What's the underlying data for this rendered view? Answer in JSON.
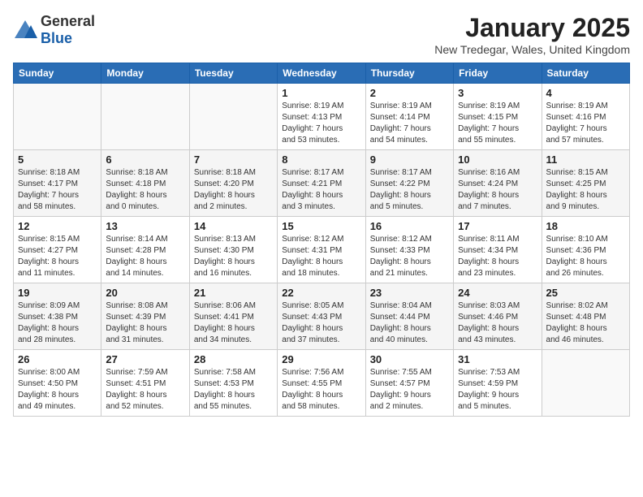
{
  "header": {
    "logo_general": "General",
    "logo_blue": "Blue",
    "title": "January 2025",
    "subtitle": "New Tredegar, Wales, United Kingdom"
  },
  "weekdays": [
    "Sunday",
    "Monday",
    "Tuesday",
    "Wednesday",
    "Thursday",
    "Friday",
    "Saturday"
  ],
  "weeks": [
    [
      {
        "day": "",
        "info": ""
      },
      {
        "day": "",
        "info": ""
      },
      {
        "day": "",
        "info": ""
      },
      {
        "day": "1",
        "info": "Sunrise: 8:19 AM\nSunset: 4:13 PM\nDaylight: 7 hours\nand 53 minutes."
      },
      {
        "day": "2",
        "info": "Sunrise: 8:19 AM\nSunset: 4:14 PM\nDaylight: 7 hours\nand 54 minutes."
      },
      {
        "day": "3",
        "info": "Sunrise: 8:19 AM\nSunset: 4:15 PM\nDaylight: 7 hours\nand 55 minutes."
      },
      {
        "day": "4",
        "info": "Sunrise: 8:19 AM\nSunset: 4:16 PM\nDaylight: 7 hours\nand 57 minutes."
      }
    ],
    [
      {
        "day": "5",
        "info": "Sunrise: 8:18 AM\nSunset: 4:17 PM\nDaylight: 7 hours\nand 58 minutes."
      },
      {
        "day": "6",
        "info": "Sunrise: 8:18 AM\nSunset: 4:18 PM\nDaylight: 8 hours\nand 0 minutes."
      },
      {
        "day": "7",
        "info": "Sunrise: 8:18 AM\nSunset: 4:20 PM\nDaylight: 8 hours\nand 2 minutes."
      },
      {
        "day": "8",
        "info": "Sunrise: 8:17 AM\nSunset: 4:21 PM\nDaylight: 8 hours\nand 3 minutes."
      },
      {
        "day": "9",
        "info": "Sunrise: 8:17 AM\nSunset: 4:22 PM\nDaylight: 8 hours\nand 5 minutes."
      },
      {
        "day": "10",
        "info": "Sunrise: 8:16 AM\nSunset: 4:24 PM\nDaylight: 8 hours\nand 7 minutes."
      },
      {
        "day": "11",
        "info": "Sunrise: 8:15 AM\nSunset: 4:25 PM\nDaylight: 8 hours\nand 9 minutes."
      }
    ],
    [
      {
        "day": "12",
        "info": "Sunrise: 8:15 AM\nSunset: 4:27 PM\nDaylight: 8 hours\nand 11 minutes."
      },
      {
        "day": "13",
        "info": "Sunrise: 8:14 AM\nSunset: 4:28 PM\nDaylight: 8 hours\nand 14 minutes."
      },
      {
        "day": "14",
        "info": "Sunrise: 8:13 AM\nSunset: 4:30 PM\nDaylight: 8 hours\nand 16 minutes."
      },
      {
        "day": "15",
        "info": "Sunrise: 8:12 AM\nSunset: 4:31 PM\nDaylight: 8 hours\nand 18 minutes."
      },
      {
        "day": "16",
        "info": "Sunrise: 8:12 AM\nSunset: 4:33 PM\nDaylight: 8 hours\nand 21 minutes."
      },
      {
        "day": "17",
        "info": "Sunrise: 8:11 AM\nSunset: 4:34 PM\nDaylight: 8 hours\nand 23 minutes."
      },
      {
        "day": "18",
        "info": "Sunrise: 8:10 AM\nSunset: 4:36 PM\nDaylight: 8 hours\nand 26 minutes."
      }
    ],
    [
      {
        "day": "19",
        "info": "Sunrise: 8:09 AM\nSunset: 4:38 PM\nDaylight: 8 hours\nand 28 minutes."
      },
      {
        "day": "20",
        "info": "Sunrise: 8:08 AM\nSunset: 4:39 PM\nDaylight: 8 hours\nand 31 minutes."
      },
      {
        "day": "21",
        "info": "Sunrise: 8:06 AM\nSunset: 4:41 PM\nDaylight: 8 hours\nand 34 minutes."
      },
      {
        "day": "22",
        "info": "Sunrise: 8:05 AM\nSunset: 4:43 PM\nDaylight: 8 hours\nand 37 minutes."
      },
      {
        "day": "23",
        "info": "Sunrise: 8:04 AM\nSunset: 4:44 PM\nDaylight: 8 hours\nand 40 minutes."
      },
      {
        "day": "24",
        "info": "Sunrise: 8:03 AM\nSunset: 4:46 PM\nDaylight: 8 hours\nand 43 minutes."
      },
      {
        "day": "25",
        "info": "Sunrise: 8:02 AM\nSunset: 4:48 PM\nDaylight: 8 hours\nand 46 minutes."
      }
    ],
    [
      {
        "day": "26",
        "info": "Sunrise: 8:00 AM\nSunset: 4:50 PM\nDaylight: 8 hours\nand 49 minutes."
      },
      {
        "day": "27",
        "info": "Sunrise: 7:59 AM\nSunset: 4:51 PM\nDaylight: 8 hours\nand 52 minutes."
      },
      {
        "day": "28",
        "info": "Sunrise: 7:58 AM\nSunset: 4:53 PM\nDaylight: 8 hours\nand 55 minutes."
      },
      {
        "day": "29",
        "info": "Sunrise: 7:56 AM\nSunset: 4:55 PM\nDaylight: 8 hours\nand 58 minutes."
      },
      {
        "day": "30",
        "info": "Sunrise: 7:55 AM\nSunset: 4:57 PM\nDaylight: 9 hours\nand 2 minutes."
      },
      {
        "day": "31",
        "info": "Sunrise: 7:53 AM\nSunset: 4:59 PM\nDaylight: 9 hours\nand 5 minutes."
      },
      {
        "day": "",
        "info": ""
      }
    ]
  ]
}
